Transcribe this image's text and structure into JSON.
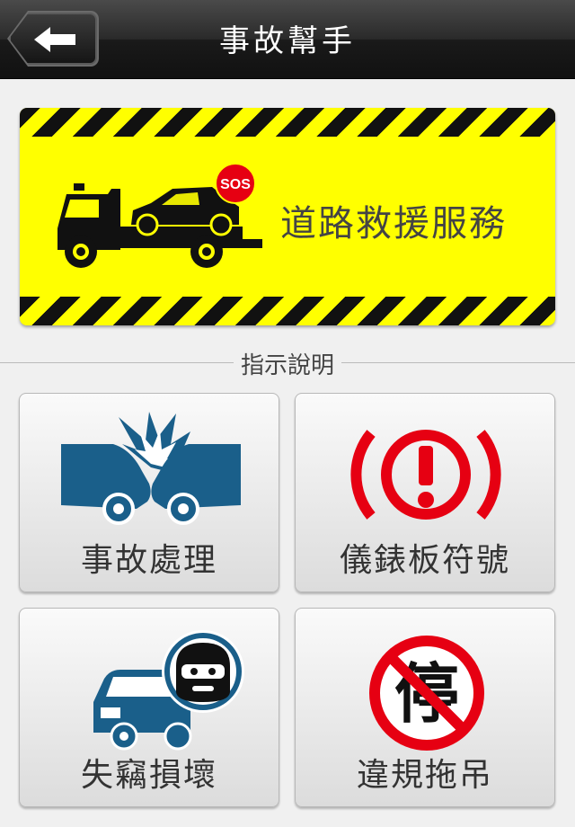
{
  "header": {
    "title": "事故幫手",
    "back_icon": "arrow-left-icon"
  },
  "banner": {
    "label": "道路救援服務",
    "badge": "SOS",
    "icon": "tow-truck-icon"
  },
  "section": {
    "title": "指示說明"
  },
  "tiles": [
    {
      "label": "事故處理",
      "icon": "car-crash-icon"
    },
    {
      "label": "儀錶板符號",
      "icon": "warning-exclamation-icon"
    },
    {
      "label": "失竊損壞",
      "icon": "car-thief-icon"
    },
    {
      "label": "違規拖吊",
      "icon": "no-parking-icon",
      "sign_text": "停"
    }
  ],
  "colors": {
    "banner_yellow": "#ffff00",
    "icon_blue": "#1a5f8a",
    "warning_red": "#e60012"
  }
}
